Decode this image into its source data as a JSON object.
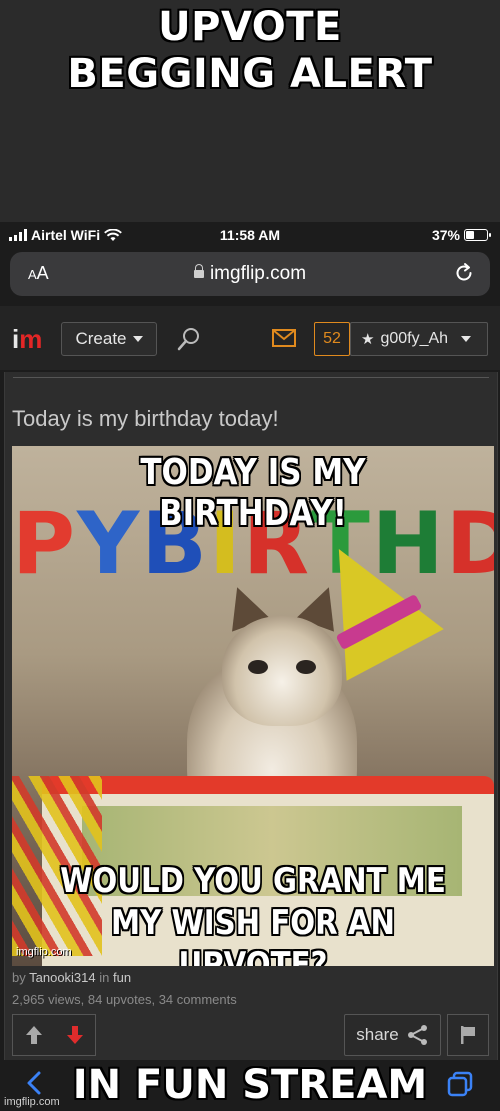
{
  "captions": {
    "top": "UPVOTE\nBEGGING ALERT",
    "bottom": "IN FUN STREAM"
  },
  "status_bar": {
    "carrier": "Airtel WiFi",
    "time": "11:58 AM",
    "battery": "37%",
    "battery_level": 0.37
  },
  "browser": {
    "text_size": "AA",
    "url": "imgflip.com"
  },
  "site_header": {
    "create_label": "Create",
    "notification_count": "52",
    "username": "g00fy_Ah"
  },
  "post": {
    "title": "Today is my birthday today!",
    "meme_top_text": "TODAY IS MY BIRTHDAY!",
    "meme_bottom_text": "WOULD YOU GRANT ME\nMY WISH FOR AN UPVOTE?",
    "banner_letters": [
      "P",
      "Y",
      " ",
      "B",
      "I",
      "R",
      "T",
      "H",
      "D"
    ],
    "watermark": "imgflip.com",
    "by_label": "by",
    "author": "Tanooki314",
    "in_label": "in",
    "stream": "fun",
    "stats": "2,965 views, 84 upvotes, 34 comments",
    "share_label": "share"
  },
  "footer_brand": "imgflip.com",
  "colors": {
    "accent_orange": "#e08a1e",
    "logo_red": "#e32626",
    "downvote": "#e02c2c",
    "ios_blue": "#3b82f6"
  }
}
